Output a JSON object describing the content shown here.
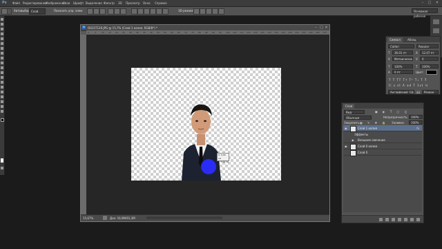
{
  "menubar": {
    "logo": "Ps",
    "items": [
      "Файл",
      "Редактирование",
      "Изображение",
      "Слои",
      "Шрифт",
      "Выделение",
      "Фильтр",
      "3D",
      "Просмотр",
      "Окно",
      "Справка"
    ],
    "win_min": "–",
    "win_max": "□",
    "win_close": "✕"
  },
  "options": {
    "autoselect": "Автовыбор:",
    "autoselect_value": "Слой",
    "show_controls": "Показать упр. элем.",
    "mode3d": "3D-режим:",
    "workspace": "Основная рабочая"
  },
  "document": {
    "title": "DSC07126.JPG @ 15,7% (Слой 1 копия, RGB/8*) *",
    "zoom": "15,67%",
    "doc_info": "Док: 16,9M/91,3M",
    "ruler_ticks": [
      "0",
      "5",
      "10",
      "15",
      "20",
      "25",
      "30",
      "35",
      "40",
      "45",
      "50",
      "55",
      "60",
      "65",
      "70",
      "75",
      "80",
      "85",
      "90",
      "95",
      "100",
      "105",
      "110",
      "115",
      "120",
      "125",
      "130",
      "135",
      "140",
      "145",
      "150",
      "155",
      "160",
      "165",
      "170"
    ],
    "tooltip_line1": "X: 0,00 см",
    "tooltip_line2": "Y: 7,06 см"
  },
  "character": {
    "tab_active": "Символ",
    "tab_other": "Абзац",
    "font": "Calibri",
    "style": "Regular",
    "size": "36,01 пт",
    "leading": "12,07 пт",
    "kerning": "Метрическое",
    "tracking": "0",
    "vscale": "100%",
    "hscale": "100%",
    "baseline": "0 пт",
    "color_label": "Цвет:",
    "lang": "Английский: США",
    "aa": "Резкое"
  },
  "layers": {
    "tab": "Слои",
    "kind": "Вид",
    "blend_mode": "Обычные",
    "opacity_label": "Непрозрачность:",
    "opacity": "100%",
    "lock_label": "Закрепить:",
    "fill_label": "Заливка:",
    "fill": "100%",
    "items": [
      {
        "name": "Слой 1 копия",
        "fx": "fx",
        "active": true
      },
      {
        "name": "Эффекты",
        "fx": "",
        "active": false
      },
      {
        "name": "Внешнее свечение",
        "fx": "",
        "active": false
      },
      {
        "name": "Слой 0 копия",
        "fx": "",
        "active": false
      },
      {
        "name": "Слой 0",
        "fx": "",
        "active": false
      }
    ]
  },
  "colors": {
    "accent_blue": "#2b2dff",
    "active_layer": "#5c6f8e"
  }
}
